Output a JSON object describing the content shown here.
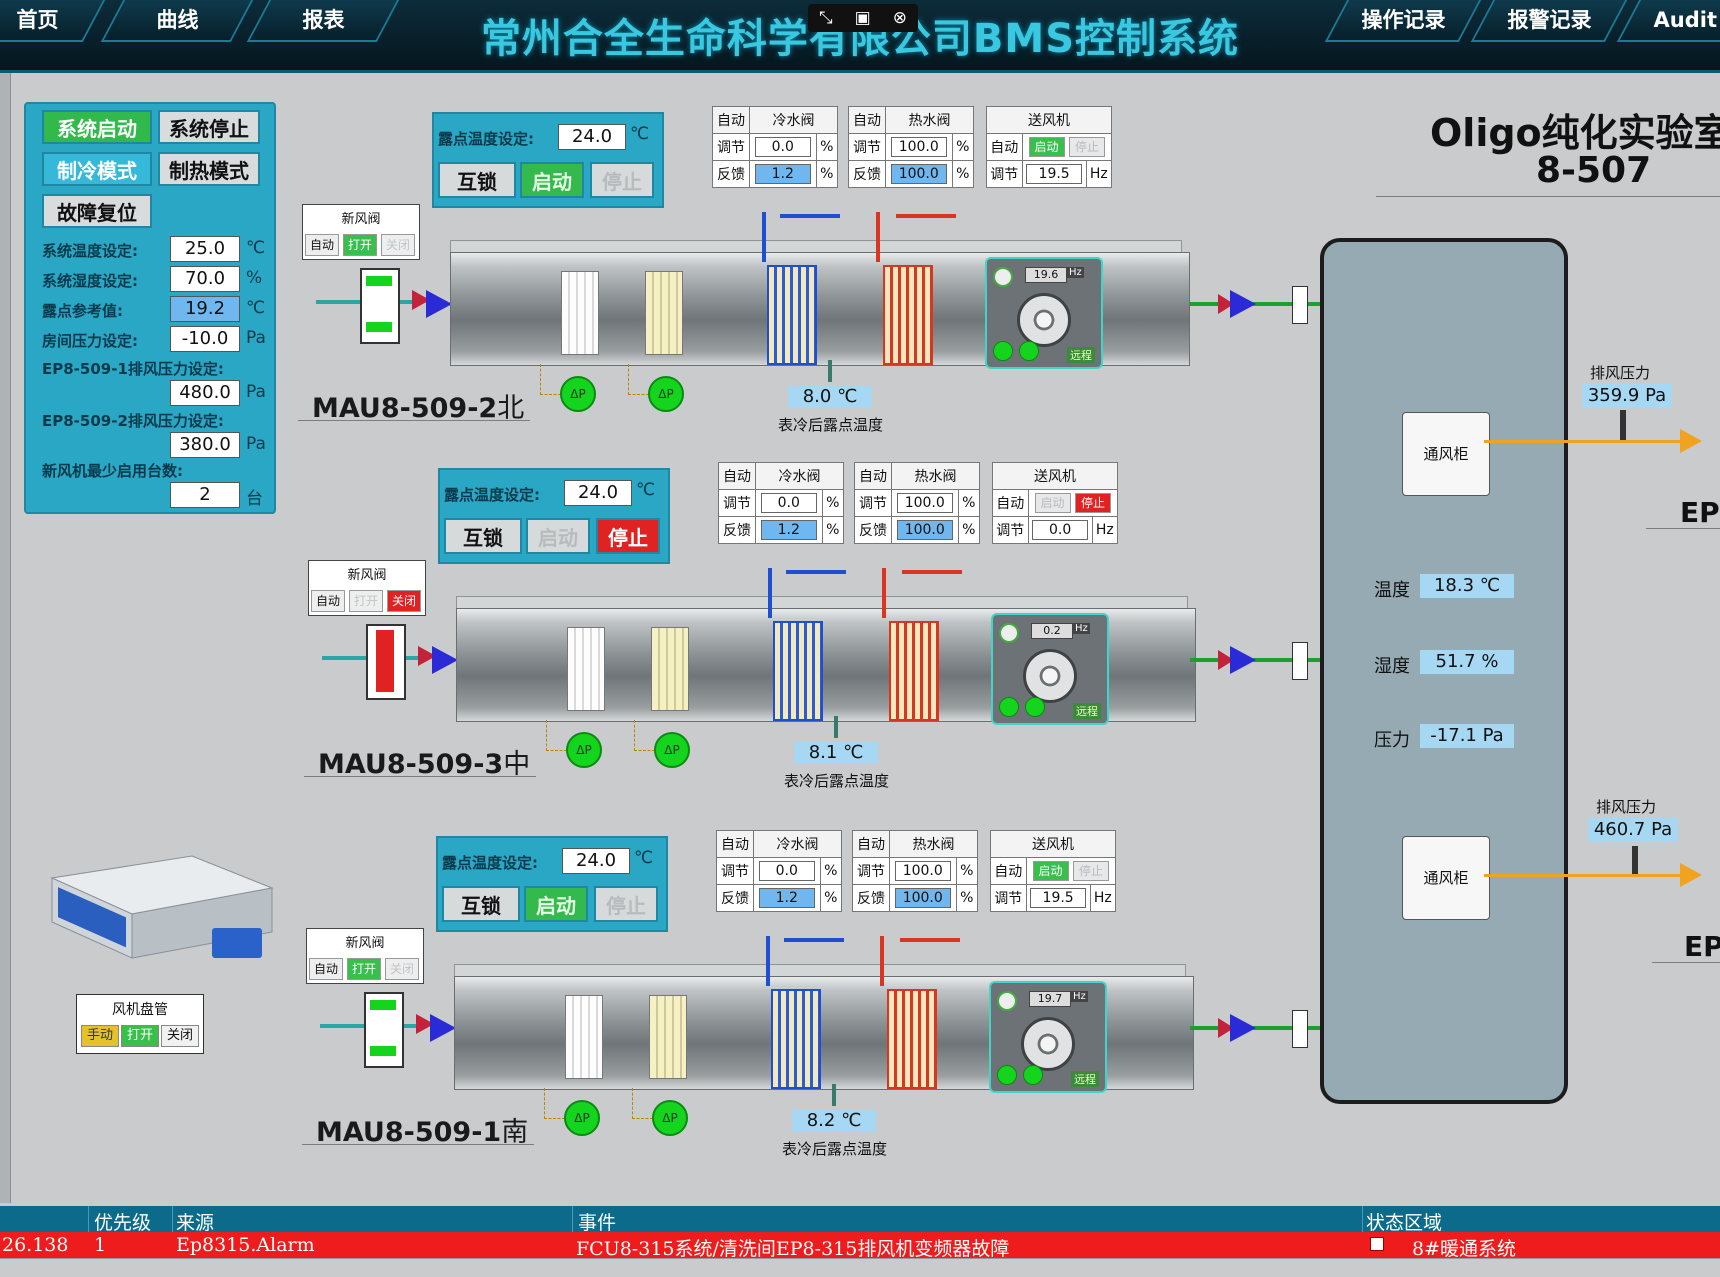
{
  "nav": {
    "home": "首页",
    "curve": "曲线",
    "report": "报表",
    "op_log": "操作记录",
    "alarm_log": "报警记录",
    "audit": "Audit"
  },
  "app_title": "常州合全生命科学有限公司BMS控制系统",
  "window_controls": [
    "⤡",
    "▣",
    "⊗"
  ],
  "left_panel": {
    "sys_start": "系统启动",
    "sys_stop": "系统停止",
    "cool_mode": "制冷模式",
    "heat_mode": "制热模式",
    "fault_reset": "故障复位",
    "temp_set_label": "系统温度设定:",
    "temp_set_value": "25.0",
    "temp_unit": "℃",
    "hum_set_label": "系统湿度设定:",
    "hum_set_value": "70.0",
    "hum_unit": "%",
    "dew_ref_label": "露点参考值:",
    "dew_ref_value": "19.2",
    "dew_ref_unit": "℃",
    "room_press_label": "房间压力设定:",
    "room_press_value": "-10.0",
    "press_unit": "Pa",
    "ep1_label": "EP8-509-1排风压力设定:",
    "ep1_value": "480.0",
    "ep2_label": "EP8-509-2排风压力设定:",
    "ep2_value": "380.0",
    "min_fan_label": "新风机最少启用台数:",
    "min_fan_value": "2",
    "min_fan_unit": "台"
  },
  "common": {
    "dew_set_label": "露点温度设定:",
    "lock": "互锁",
    "start": "启动",
    "stop": "停止",
    "auto": "自动",
    "adjust": "调节",
    "feedback": "反馈",
    "cold_valve": "冷水阀",
    "hot_valve": "热水阀",
    "supply_fan": "送风机",
    "pct": "%",
    "hz": "Hz",
    "c": "℃",
    "fresh_damper": "新风阀",
    "open": "打开",
    "close": "关闭",
    "after_coil_dew": "表冷后露点温度",
    "dp": "ΔP",
    "hz_tag": "Hz",
    "fan_tag": "远程"
  },
  "units": [
    {
      "name": "MAU8-509-2",
      "dir": "北",
      "dew_set": "24.0",
      "cold_adjust": "0.0",
      "cold_feedback": "1.2",
      "hot_adjust": "100.0",
      "hot_feedback": "100.0",
      "fan_hz_set": "19.5",
      "fan_hz": "19.6",
      "dew_after": "8.0",
      "running": true,
      "damper_open": true
    },
    {
      "name": "MAU8-509-3",
      "dir": "中",
      "dew_set": "24.0",
      "cold_adjust": "0.0",
      "cold_feedback": "1.2",
      "hot_adjust": "100.0",
      "hot_feedback": "100.0",
      "fan_hz_set": "0.0",
      "fan_hz": "0.2",
      "dew_after": "8.1",
      "running": false,
      "damper_open": false
    },
    {
      "name": "MAU8-509-1",
      "dir": "南",
      "dew_set": "24.0",
      "cold_adjust": "0.0",
      "cold_feedback": "1.2",
      "hot_adjust": "100.0",
      "hot_feedback": "100.0",
      "fan_hz_set": "19.5",
      "fan_hz": "19.7",
      "dew_after": "8.2",
      "running": true,
      "damper_open": true
    }
  ],
  "room": {
    "title": "Oligo纯化实验室",
    "number": "8-507",
    "cabinet": "通风柜",
    "temp_label": "温度",
    "temp_value": "18.3",
    "temp_unit": "℃",
    "hum_label": "湿度",
    "hum_value": "51.7",
    "hum_unit": "%",
    "press_label": "压力",
    "press_value": "-17.1",
    "press_unit": "Pa"
  },
  "exhaust": [
    {
      "label": "排风压力",
      "value": "359.9",
      "unit": "Pa",
      "ep": "EP"
    },
    {
      "label": "排风压力",
      "value": "460.7",
      "unit": "Pa",
      "ep": "EP"
    }
  ],
  "fcu": {
    "title": "风机盘管",
    "manual": "手动",
    "open": "打开",
    "close": "关闭"
  },
  "alarm": {
    "headers": {
      "priority": "优先级",
      "source": "来源",
      "event": "事件",
      "state_area": "状态区域"
    },
    "row": {
      "time": "26.138",
      "priority": "1",
      "source": "Ep8315.Alarm",
      "event": "FCU8-315系统/清洗间EP8-315排风机变频器故障",
      "area": "8#暖通系统"
    }
  },
  "colors": {
    "panel": "#2aa7c4",
    "run_green": "#33b94c",
    "stop_red": "#e02222",
    "readout_blue": "#a6d8f3",
    "alarm_red": "#ee1c1c"
  }
}
